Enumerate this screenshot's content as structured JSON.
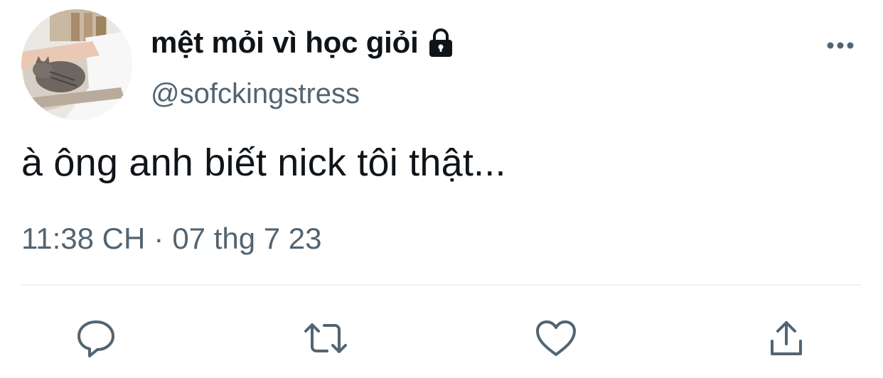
{
  "tweet": {
    "display_name": "mệt mỏi vì học giỏi",
    "handle": "@sofckingstress",
    "text": "à ông anh biết nick tôi thật...",
    "time": "11:38 CH",
    "separator": "·",
    "date": "07 thg 7 23"
  },
  "icons": {
    "protected": "lock-icon",
    "more": "more-dots-icon",
    "reply": "reply-bubble-icon",
    "retweet": "retweet-icon",
    "like": "heart-icon",
    "share": "share-upload-icon"
  },
  "colors": {
    "text_primary": "#0f1419",
    "text_secondary": "#536471",
    "divider": "#eff3f4"
  }
}
